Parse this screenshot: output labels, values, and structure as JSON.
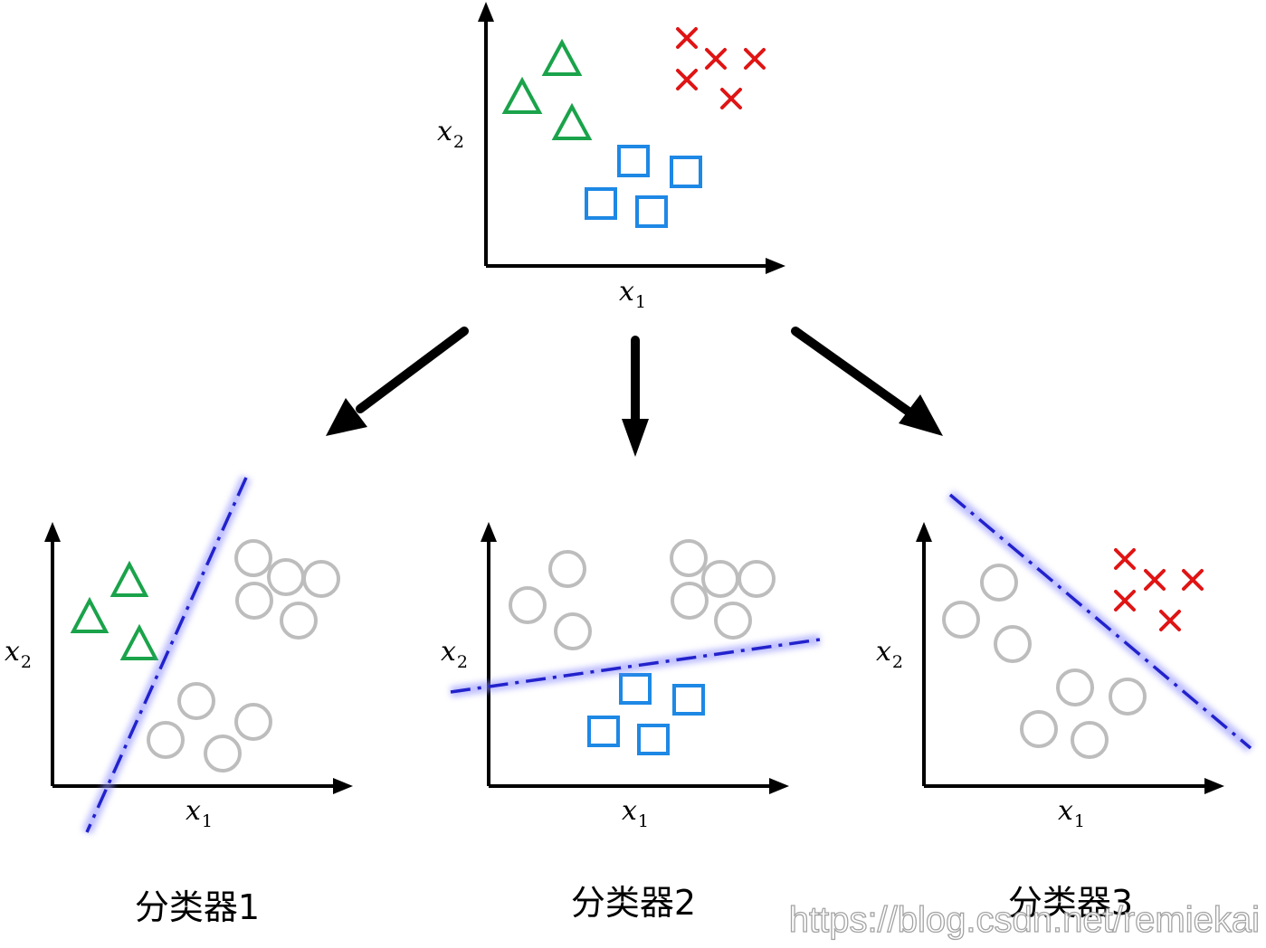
{
  "colors": {
    "triangle": "#1aa34a",
    "cross": "#e01414",
    "square": "#1e88e5",
    "circle": "#bdbdbd",
    "boundary": "#2222cc",
    "boundary_glow": "#8a8aff",
    "axis": "#000000"
  },
  "axis_labels": {
    "x_main": "x",
    "x_sub": "1",
    "y_main": "x",
    "y_sub": "2"
  },
  "symbols": {
    "triangle": "triangle-marker",
    "cross": "cross-marker",
    "square": "square-marker",
    "circle": "circle-marker"
  },
  "captions": {
    "classifier_1": "分类器1",
    "classifier_2": "分类器2",
    "classifier_3": "分类器3"
  },
  "watermark": "https://blog.csdn.net/remiekai"
}
